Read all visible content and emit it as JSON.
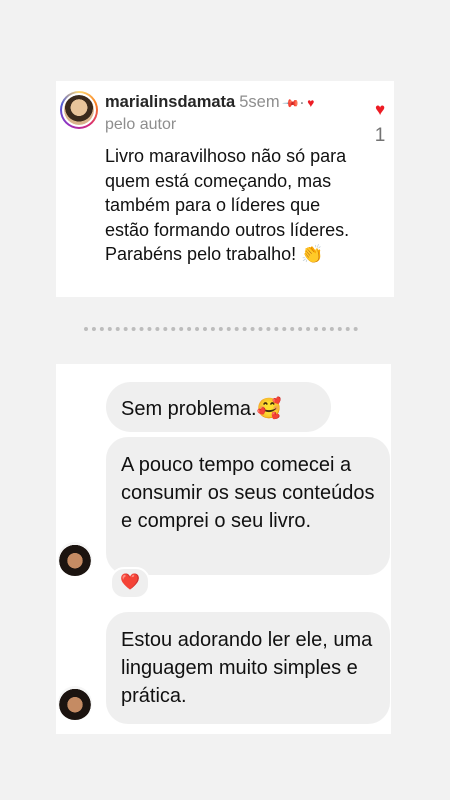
{
  "comment": {
    "username": "marialinsdamata",
    "time": "5sem",
    "pin_icon": "pin-icon",
    "dot": "·",
    "liked_by_author_icon": "heart-icon",
    "byline": "pelo autor",
    "text": "Livro maravilhoso não só para quem está começando, mas também para o líderes que estão formando outros líderes. Parabéns pelo trabalho! 👏",
    "like_icon": "heart-icon",
    "like_count": "1"
  },
  "chat": {
    "messages": [
      {
        "text": "Sem problema.🥰"
      },
      {
        "text": "A pouco tempo comecei a consumir os seus conteúdos e comprei o seu livro."
      },
      {
        "text": "Estou adorando ler ele, uma linguagem muito simples e prática."
      }
    ],
    "reaction": "❤️"
  },
  "colors": {
    "background": "#f2f2f2",
    "card": "#ffffff",
    "bubble": "#efefef",
    "like": "#ed1c24",
    "secondary_text": "#8e8e8e"
  }
}
